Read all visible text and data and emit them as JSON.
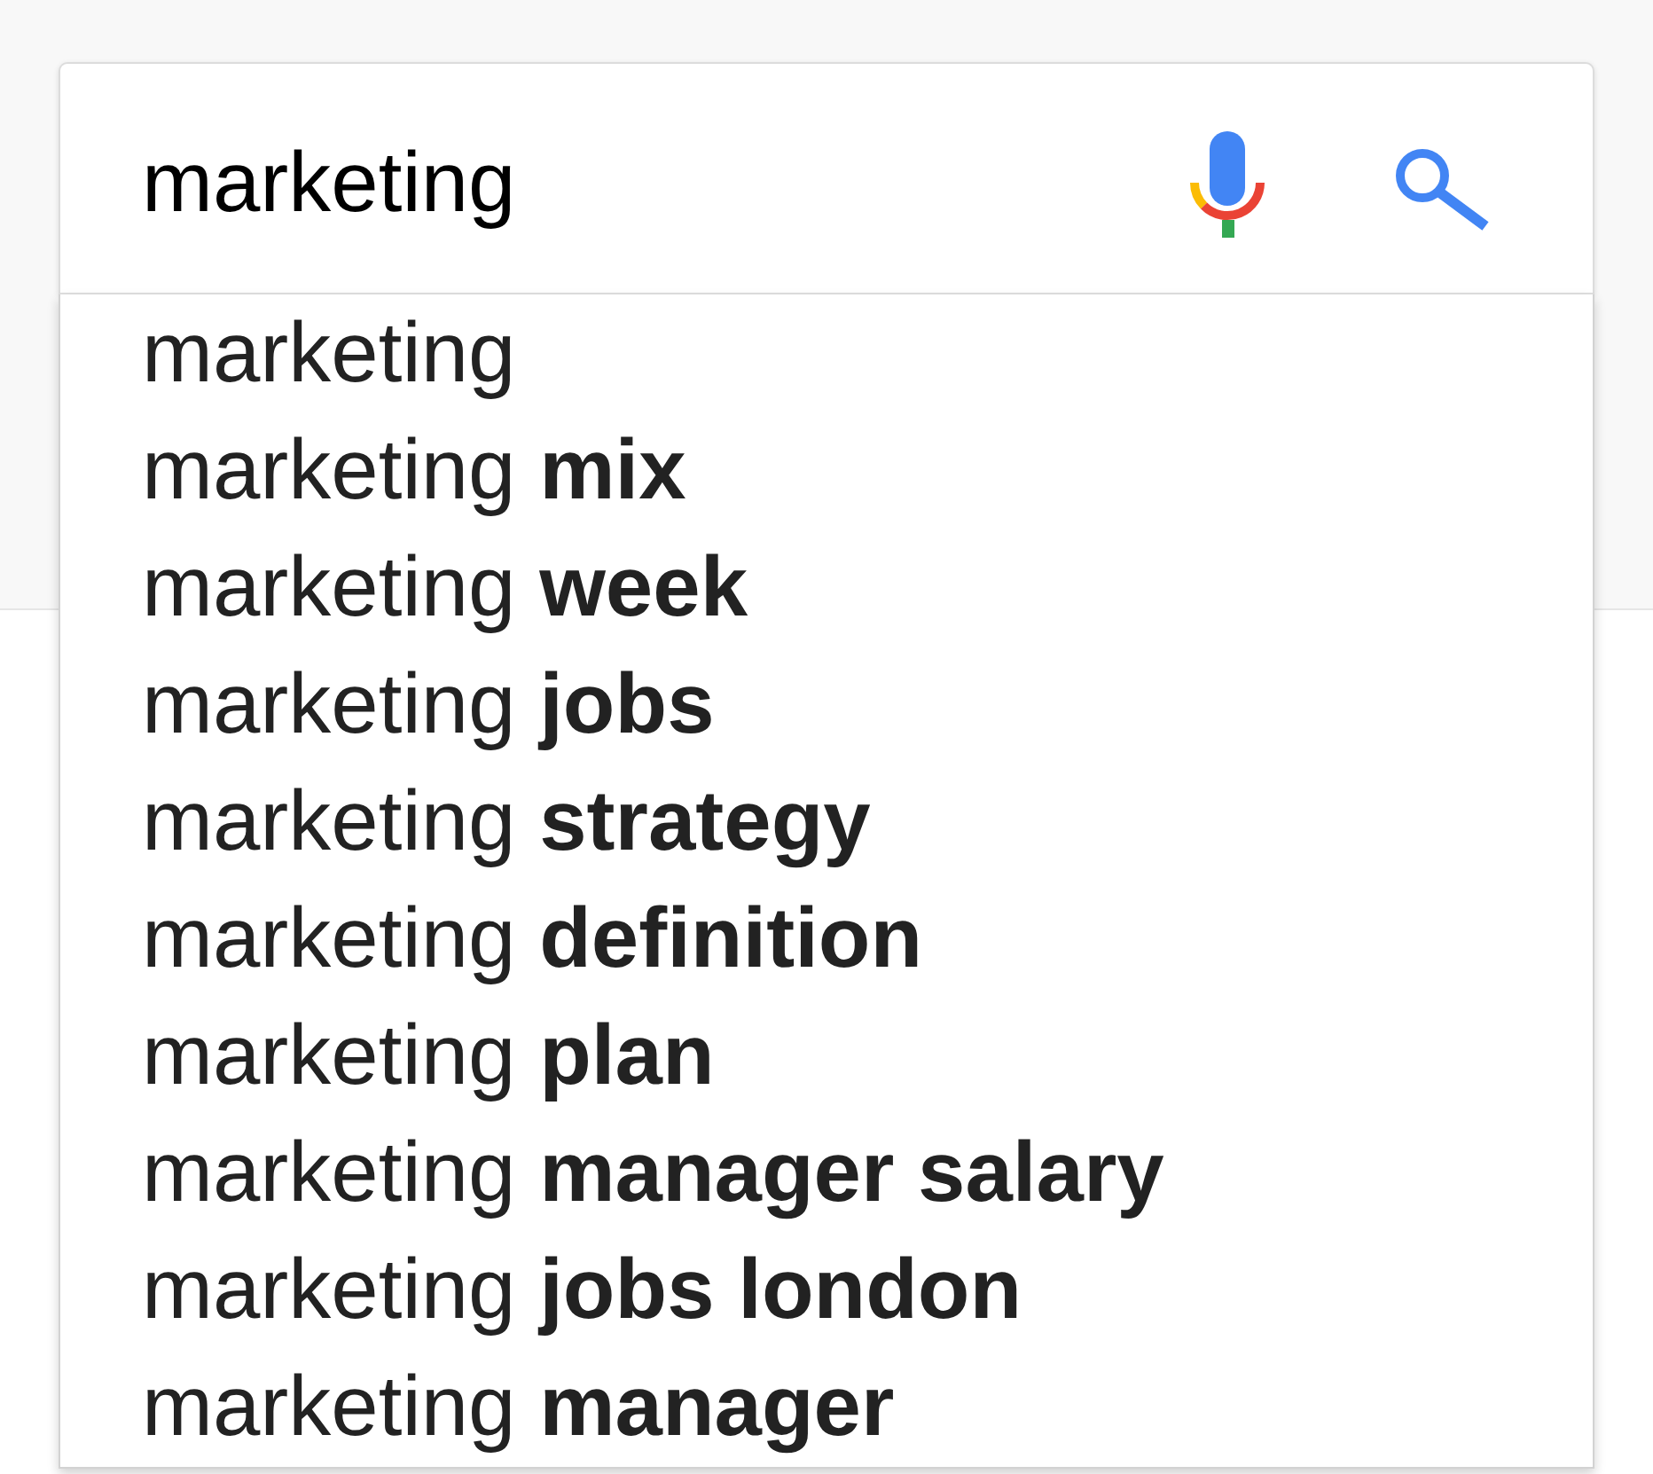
{
  "search": {
    "value": "marketing"
  },
  "suggestions": [
    "marketing",
    "marketing **mix**",
    "marketing **week**",
    "marketing **jobs**",
    "marketing **strategy**",
    "marketing **definition**",
    "marketing **plan**",
    "marketing **manager salary**",
    "marketing **jobs london**",
    "marketing **manager**"
  ]
}
